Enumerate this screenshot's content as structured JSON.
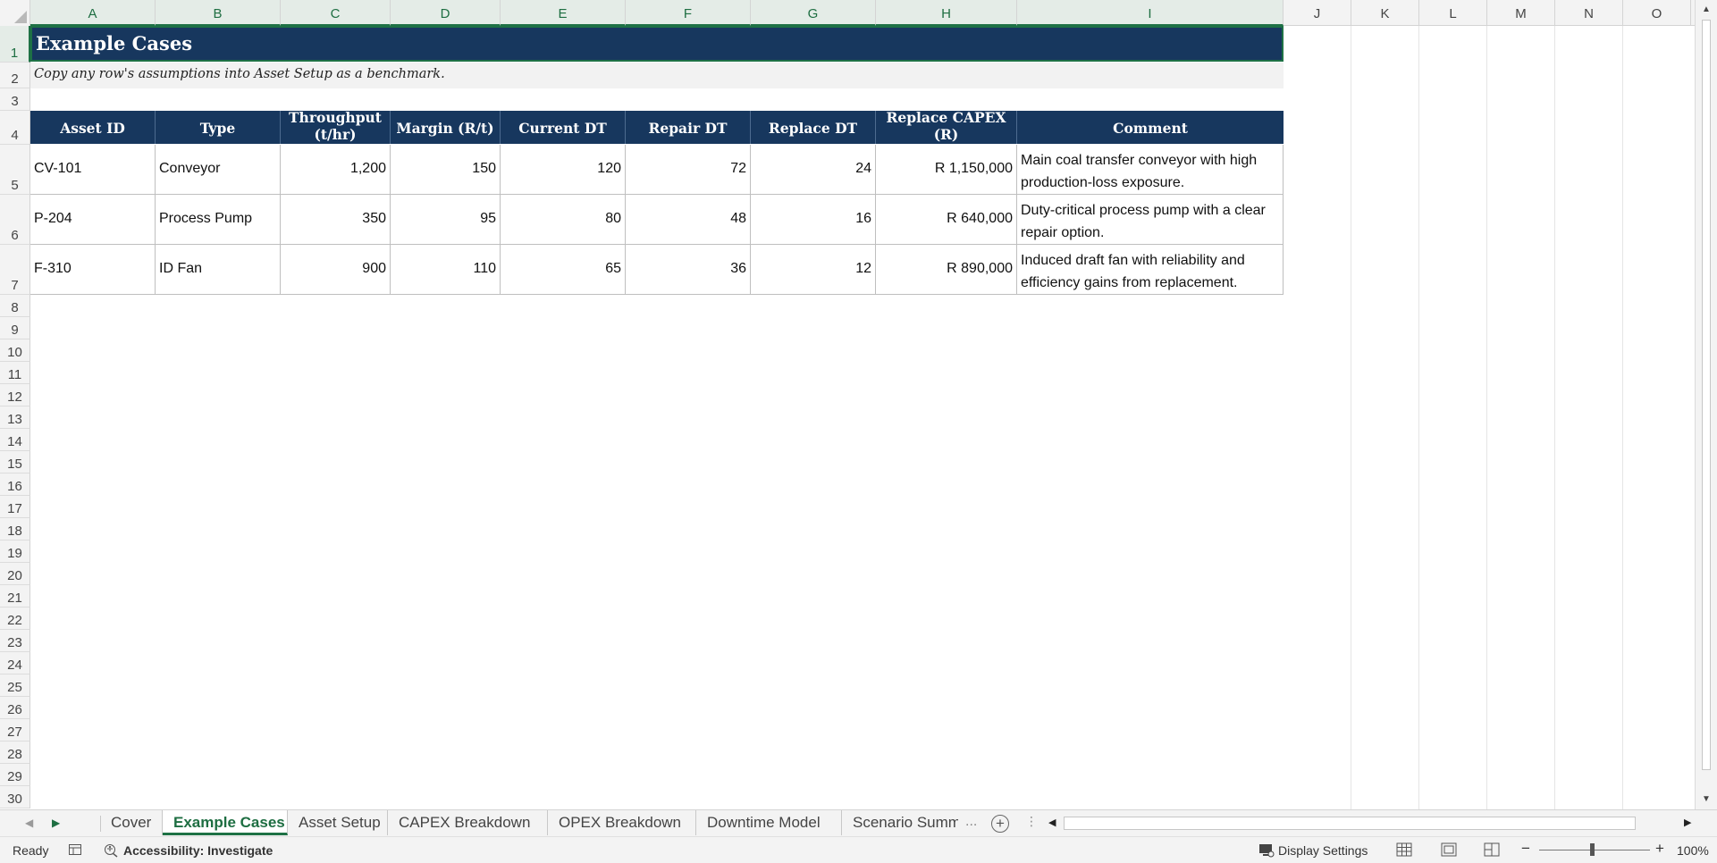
{
  "columns": [
    "A",
    "B",
    "C",
    "D",
    "E",
    "F",
    "G",
    "H",
    "I",
    "J",
    "K",
    "L",
    "M",
    "N",
    "O"
  ],
  "rows": [
    "1",
    "2",
    "3",
    "4",
    "5",
    "6",
    "7",
    "8",
    "9",
    "10",
    "11",
    "12",
    "13",
    "14",
    "15",
    "16",
    "17",
    "18",
    "19",
    "20",
    "21",
    "22",
    "23",
    "24",
    "25",
    "26",
    "27",
    "28",
    "29",
    "30"
  ],
  "sheet": {
    "title": "Example Cases",
    "subtitle": "Copy any row's assumptions into Asset Setup as a benchmark.",
    "headers": [
      "Asset ID",
      "Type",
      "Throughput (t/hr)",
      "Margin (R/t)",
      "Current DT",
      "Repair DT",
      "Replace DT",
      "Replace CAPEX (R)",
      "Comment"
    ],
    "table": [
      [
        "CV-101",
        "Conveyor",
        "1,200",
        "150",
        "120",
        "72",
        "24",
        "R 1,150,000",
        "Main coal transfer conveyor with high production-loss exposure."
      ],
      [
        "P-204",
        "Process Pump",
        "350",
        "95",
        "80",
        "48",
        "16",
        "R 640,000",
        "Duty-critical process pump with a clear repair option."
      ],
      [
        "F-310",
        "ID Fan",
        "900",
        "110",
        "65",
        "36",
        "12",
        "R 890,000",
        "Induced draft fan with reliability and efficiency gains from replacement."
      ]
    ]
  },
  "tabs": {
    "items": [
      "Cover",
      "Example Cases",
      "Asset Setup",
      "CAPEX Breakdown",
      "OPEX Breakdown",
      "Downtime Model",
      "Scenario Summ"
    ],
    "active": "Example Cases",
    "overflow": "..."
  },
  "status": {
    "ready": "Ready",
    "accessibility": "Accessibility: Investigate",
    "display_settings": "Display Settings",
    "zoom": "100%"
  },
  "icons": {
    "scroll_up": "scroll-up-icon",
    "scroll_down": "scroll-down-icon",
    "add_sheet": "plus-circle-icon",
    "normal_view": "grid-icon",
    "page_layout": "page-layout-icon",
    "page_break": "page-break-icon"
  },
  "colors": {
    "header_fill": "#17375e",
    "accent": "#1e7145",
    "subtitle_fill": "#f2f2f2"
  }
}
